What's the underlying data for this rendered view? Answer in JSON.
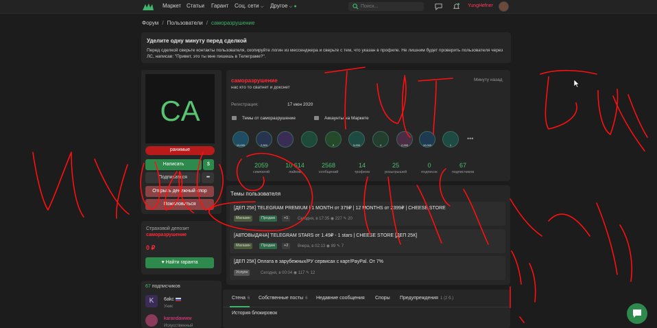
{
  "topbar": {
    "nav": [
      "Маркет",
      "Статьи",
      "Гарант",
      "Соц. сети",
      "Другое"
    ],
    "search_placeholder": "Поиск...",
    "username": "YungHefner"
  },
  "breadcrumb": [
    "Форум",
    "Пользователи",
    "саморазрушение"
  ],
  "notice": {
    "title": "Уделите одну минуту перед сделкой",
    "text": "Перед сделкой сверьте контакты пользователя, скопируйте логин из мессенджера и сверьте с тем, что указан в профиле. Не лишним будет проверить пользователя через ЛС, написав: \"Привет, это ты мне пишешь в Телеграме?\"."
  },
  "profile": {
    "avatar_initials": "CA",
    "badge": "ранимые",
    "name": "саморазрушение",
    "status": "нас кто то сватнет и докснет",
    "last_seen": "Минуту назад",
    "reg_label": "Регистрация:",
    "reg_date": "17 июн 2020",
    "link_threads": "Темы от саморазрушение",
    "link_accounts": "Аккаунты на Маркете",
    "trophies": [
      "10,000",
      "2,500",
      "",
      "",
      "2",
      "5,000",
      "4",
      "2,000",
      "10,000",
      "1"
    ],
    "more": "•••",
    "stats": [
      {
        "value": "2059",
        "label": "симпатий"
      },
      {
        "value": "10 614",
        "label": "лайков"
      },
      {
        "value": "2568",
        "label": "сообщений"
      },
      {
        "value": "14",
        "label": "трофеев"
      },
      {
        "value": "25",
        "label": "розыгрышей"
      },
      {
        "value": "0",
        "label": "подписок"
      },
      {
        "value": "67",
        "label": "подписчиков"
      }
    ]
  },
  "buttons": {
    "write": "Написать",
    "dollar": "$",
    "subscribe": "Подписаться",
    "dots": "•••",
    "dispute": "Открыть денежный спор",
    "report": "Пожаловаться",
    "guarantor": "Найти гаранта"
  },
  "deposit": {
    "label": "Страховой депозит",
    "name": "саморазрушение",
    "amount": "0 ₽"
  },
  "subscribers": {
    "title_count": "67",
    "title_text": "подписчиков",
    "list": [
      {
        "initial": "K",
        "name": "6akc",
        "role": "Уник"
      },
      {
        "initial": "",
        "name": "karandawww",
        "role": "Искусственный"
      }
    ]
  },
  "threads_block": {
    "title": "Темы пользователя",
    "items": [
      {
        "title": "[ДЕП 25К] TELEGRAM PREMIUM | 1 MONTH от 379₽ | 12 MONTHS от 2399₽ | CHEESE STORE",
        "tags": [
          "Магазин",
          "Продам",
          "+1"
        ],
        "date": "Сегодня, в 17:35",
        "views": "227",
        "replies": "20"
      },
      {
        "title": "[АВТОВЫДАЧА] TELEGRAM STARS от 1.49₽ - 1 stars | CHEESE STORE [ДЕП 25К]",
        "tags": [
          "Магазин",
          "Продам",
          "+2"
        ],
        "date": "Вчера, в 02:13",
        "views": "89",
        "replies": "7"
      },
      {
        "title": "[ДЕП 25К] Оплата в зарубежных/РУ сервисах с карт/PayPal. От 7%",
        "tags": [
          "Услуги"
        ],
        "date": "Сегодня, в 00:04",
        "views": "117",
        "replies": "12"
      }
    ]
  },
  "tabs": {
    "items": [
      {
        "label": "Стена",
        "count": "6"
      },
      {
        "label": "Собственные посты",
        "count": "6"
      },
      {
        "label": "Недавние сообщения",
        "count": ""
      },
      {
        "label": "Споры",
        "count": ""
      },
      {
        "label": "Предупреждения",
        "count": "1 (2 б.)"
      }
    ],
    "history": "История блокировок"
  },
  "colors": {
    "accent_green": "#4cc06f",
    "name_red": "#ff2b3b",
    "scribble": "#ff1010"
  }
}
